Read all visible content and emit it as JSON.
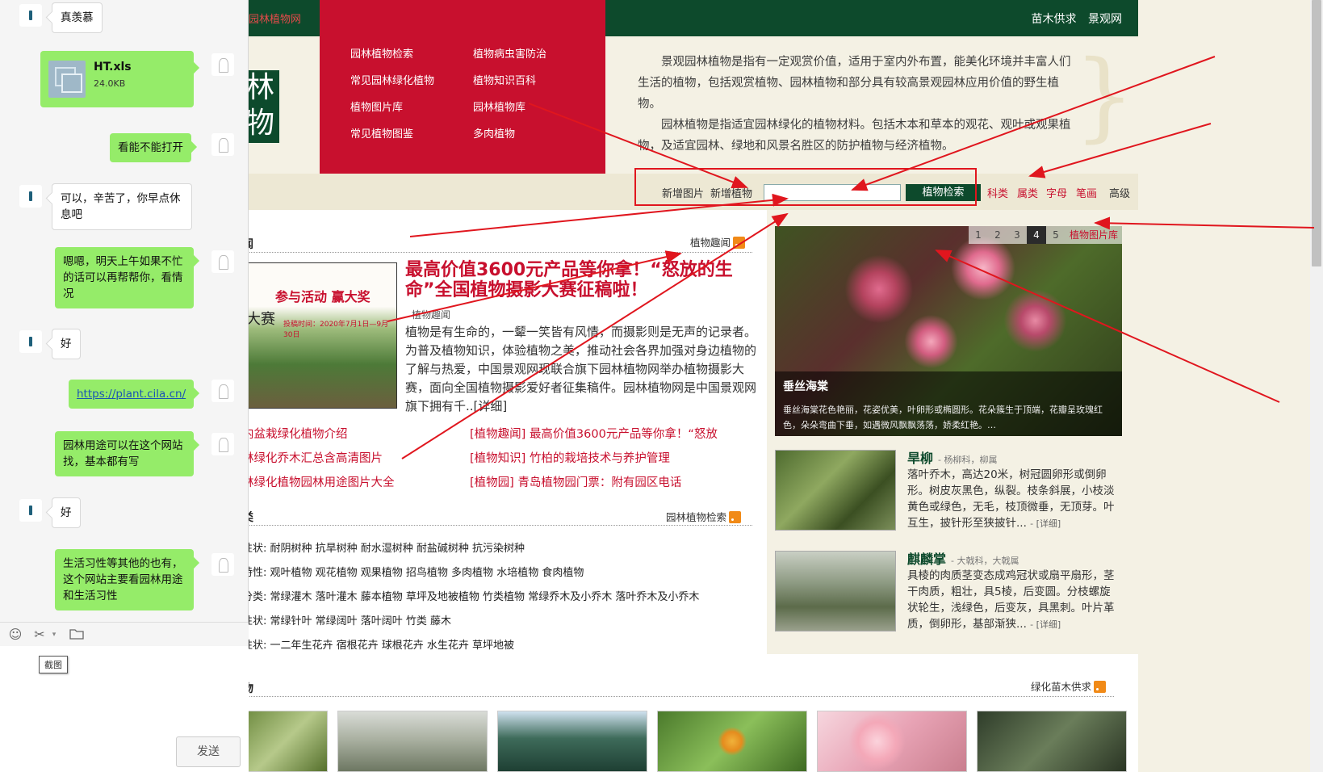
{
  "site": {
    "top_left_link": "园林植物网",
    "top_right": [
      "苗木供求",
      "景观网"
    ],
    "logo_text": "林\n物",
    "menu": [
      {
        "label": "园林植物检索"
      },
      {
        "label": "植物病虫害防治"
      },
      {
        "label": "常见园林绿化植物"
      },
      {
        "label": "植物知识百科"
      },
      {
        "label": "植物图片库"
      },
      {
        "label": "园林植物库"
      },
      {
        "label": "常见植物图鉴"
      },
      {
        "label": "多肉植物"
      }
    ],
    "intro_p1": "景观园林植物是指有一定观赏价值，适用于室内外布置，能美化环境并丰富人们生活的植物，包括观赏植物、园林植物和部分具有较高景观园林应用价值的野生植物。",
    "intro_p2": "园林植物是指适宜园林绿化的植物材料。包括木本和草本的观花、观叶或观果植物，及适宜园林、绿地和风景名胜区的防护植物与经济植物。",
    "search": {
      "add_image": "新增图片",
      "add_plant": "新增植物",
      "input_value": "",
      "button": "植物检索",
      "links": [
        "科类",
        "属类",
        "字母",
        "笔画",
        "高级"
      ]
    },
    "news": {
      "section_title": "闻",
      "more_label": "植物趣闻",
      "image_badge": "参与活动 赢大奖",
      "image_badge2": "大赛",
      "image_date": "投稿时间：2020年7月1日—9月30日",
      "headline": "最高价值3600元产品等你拿！“怒放的生命”全国植物摄影大赛征稿啦！",
      "headline_tag": "植物趣闻",
      "body": "植物是有生命的，一颦一笑皆有风情，而摄影则是无声的记录者。为普及植物知识，体验植物之美，推动社会各界加强对身边植物的了解与热爱，中国景观网现联合旗下园林植物网举办植物摄影大赛，面向全国植物摄影爱好者征集稿件。园林植物网是中国景观网旗下拥有千..[详细]",
      "left_links": [
        "内盆栽绿化植物介绍",
        "林绿化乔木汇总含高清图片",
        "林绿化植物园林用途图片大全"
      ],
      "right_links": [
        {
          "tag": "[植物趣闻]",
          "text": "最高价值3600元产品等你拿！“怒放"
        },
        {
          "tag": "[植物知识]",
          "text": "竹柏的栽培技术与养护管理"
        },
        {
          "tag": "[植物园]",
          "text": "青岛植物园门票：附有园区电话"
        }
      ]
    },
    "classify": {
      "section_title": "类",
      "more_label": "园林植物检索",
      "rows": [
        {
          "label": "性状:",
          "items": "耐阴树种 抗旱树种 耐水湿树种 耐盐碱树种 抗污染树种"
        },
        {
          "label": "特性:",
          "items": "观叶植物 观花植物 观果植物 招鸟植物 多肉植物 水培植物 食肉植物"
        },
        {
          "label": "分类:",
          "items": "常绿灌木 落叶灌木 藤本植物 草坪及地被植物 竹类植物 常绿乔木及小乔木 落叶乔木及小乔木"
        },
        {
          "label": "性状:",
          "items": "常绿针叶 常绿阔叶 落叶阔叶 竹类 藤木"
        },
        {
          "label": "性状:",
          "items": "一二年生花卉 宿根花卉 球根花卉 水生花卉 草坪地被"
        }
      ]
    },
    "slider": {
      "pager": [
        "1",
        "2",
        "3",
        "4",
        "5"
      ],
      "active_page": "4",
      "pager_link": "植物图片库",
      "caption_title": "垂丝海棠",
      "caption_desc": "垂丝海棠花色艳丽，花姿优美，叶卵形或椭圆形。花朵簇生于顶端，花瓣呈玫瑰红色，朵朵弯曲下垂，如遇微风飘飘荡荡，娇柔红艳。…"
    },
    "cards": [
      {
        "title": "旱柳",
        "family": "- 杨柳科，柳属",
        "desc": "落叶乔木，高达20米，树冠圆卵形或倒卵形。树皮灰黑色，纵裂。枝条斜展，小枝淡黄色或绿色，无毛，枝顶微垂，无顶芽。叶互生，披针形至狭披针...",
        "more": "- [详细]"
      },
      {
        "title": "麒麟掌",
        "family": "- 大戟科，大戟属",
        "desc": "具棱的肉质茎变态成鸡冠状或扇平扇形，茎干肉质，粗壮，具5棱，后变圆。分枝螺旋状轮生，浅绿色，后变灰，具黑刺。叶片革质，倒卵形，基部渐狭...",
        "more": "- [详细]"
      }
    ],
    "bottom": {
      "section_title": "物",
      "more_label": "绿化苗木供求"
    }
  },
  "chat": {
    "messages": [
      {
        "side": "left",
        "text": "真羡慕"
      },
      {
        "side": "right",
        "type": "file",
        "name": "HT.xls",
        "size": "24.0KB"
      },
      {
        "side": "right",
        "text": "看能不能打开"
      },
      {
        "side": "left",
        "text": "可以，辛苦了，你早点休息吧"
      },
      {
        "side": "right",
        "text": "嗯嗯，明天上午如果不忙的话可以再帮帮你，看情况"
      },
      {
        "side": "left",
        "text": "好"
      },
      {
        "side": "right",
        "text": "https://plant.cila.cn/",
        "link": true
      },
      {
        "side": "right",
        "text": "园林用途可以在这个网站找，基本都有写"
      },
      {
        "side": "left",
        "text": "好"
      },
      {
        "side": "right",
        "text": "生活习性等其他的也有，这个网站主要看园林用途和生活习性"
      }
    ],
    "tooltip": "截图",
    "send_label": "发送",
    "icons": [
      "emoji-icon",
      "scissors-icon",
      "folder-icon"
    ]
  },
  "colors": {
    "brand_green": "#0d4a2c",
    "brand_red": "#c8102e",
    "chat_green": "#95ec69",
    "annotation_red": "#e0161e"
  }
}
